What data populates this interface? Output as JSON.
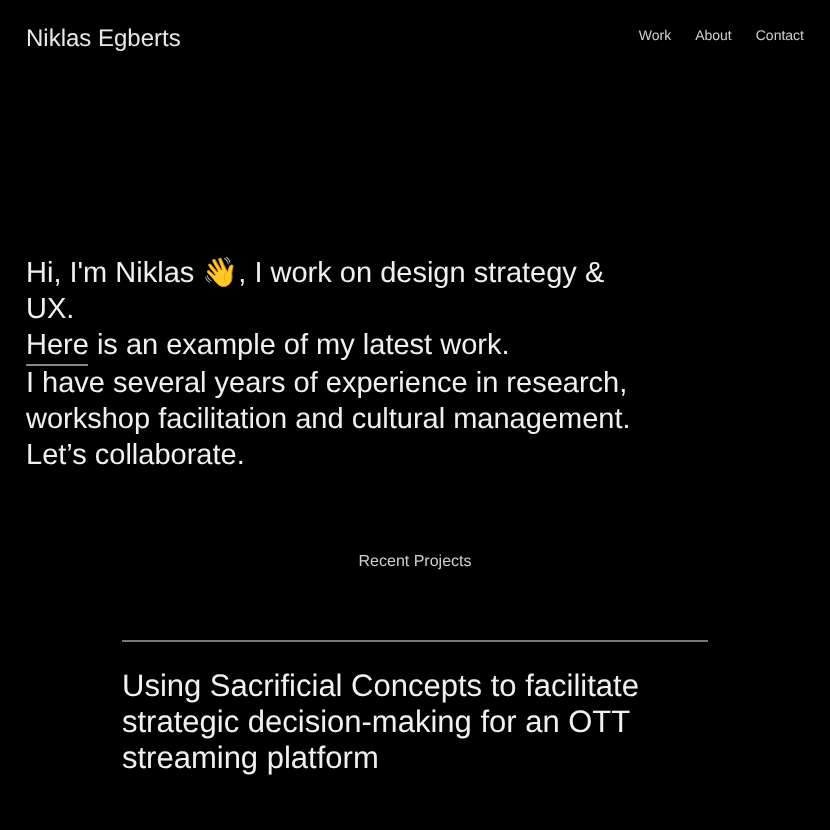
{
  "header": {
    "name": "Niklas Egberts",
    "nav": [
      {
        "label": "Work"
      },
      {
        "label": "About"
      },
      {
        "label": "Contact"
      }
    ]
  },
  "intro": [
    {
      "kind": "text",
      "text": "Hi, I'm Niklas 👋, I work on design strategy & UX."
    },
    {
      "kind": "link",
      "link": "Here",
      "text": "is an example of my latest work."
    },
    {
      "kind": "text",
      "text": "I have several years of experience in research, workshop facilitation and cultural management."
    },
    {
      "kind": "text",
      "text": "Let’s collaborate."
    }
  ],
  "projects": {
    "heading": "Recent Projects",
    "items": [
      {
        "title": "Using Sacrificial Concepts to facilitate strategic decision-making for an OTT streaming platform"
      }
    ]
  }
}
